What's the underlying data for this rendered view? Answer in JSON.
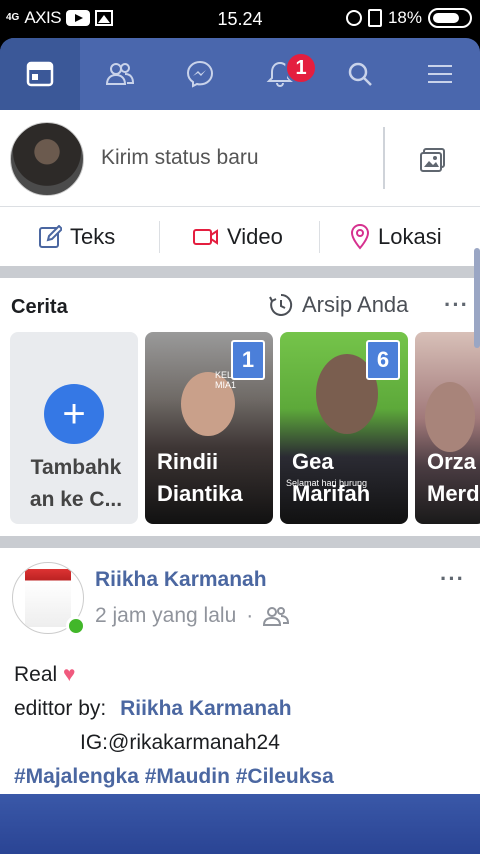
{
  "status_bar": {
    "network": "4G",
    "carrier": "AXIS",
    "time": "15.24",
    "battery": "18%"
  },
  "nav": {
    "notification_count": "1",
    "items": [
      "news-feed",
      "friends",
      "messenger",
      "notifications",
      "search",
      "menu"
    ]
  },
  "composer": {
    "placeholder": "Kirim status baru"
  },
  "actions": {
    "text": "Teks",
    "video": "Video",
    "location": "Lokasi"
  },
  "stories": {
    "title": "Cerita",
    "archive": "Arsip Anda",
    "add_line1": "Tambahk",
    "add_line2": "an ke C...",
    "items": [
      {
        "first": "Rindii",
        "last": "Diantika",
        "count": "1",
        "overlay": "KELAS XI MIA1"
      },
      {
        "first": "Gea",
        "last": "Marifah",
        "count": "6",
        "overlay": "Selamat hari burung"
      },
      {
        "first": "Orza",
        "last": "Merd"
      }
    ]
  },
  "post": {
    "author": "Riikha Karmanah",
    "time": "2 jam yang lalu",
    "separator": "·",
    "line1": "Real",
    "line2_prefix": "edittor by:",
    "line2_tag": "Riikha Karmanah",
    "line3": "IG:@rikakarmanah24",
    "hashtags": "#Majalengka #Maudin #Cileuksa"
  },
  "colors": {
    "nav_blue": "#4a67ad",
    "nav_active": "#3b5898",
    "badge_red": "#e41e3f",
    "link_blue": "#4b67a1",
    "add_blue": "#3578e5"
  }
}
